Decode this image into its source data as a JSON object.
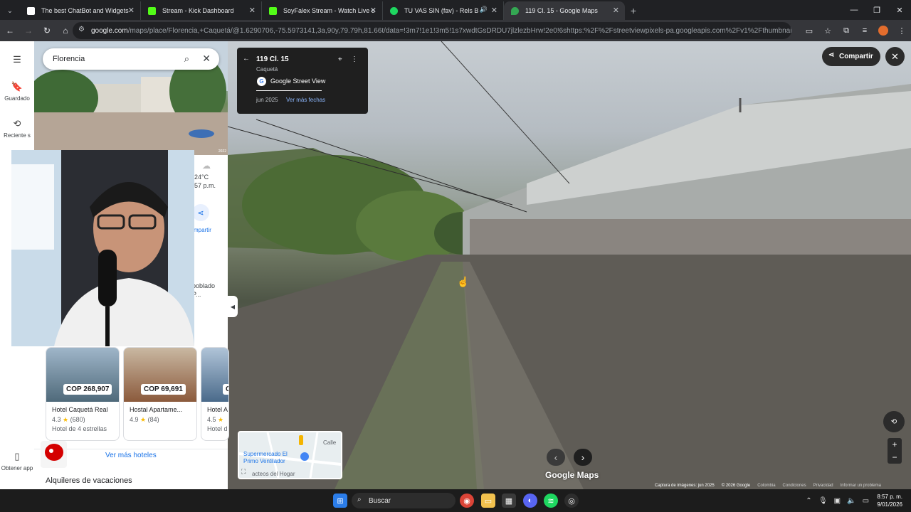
{
  "browser": {
    "tabs": [
      {
        "title": "The best ChatBot and Widgets",
        "favicon_color": "#ffffff"
      },
      {
        "title": "Stream - Kick Dashboard",
        "favicon_color": "#53fc18"
      },
      {
        "title": "SoyFalex Stream - Watch Live o",
        "favicon_color": "#53fc18"
      },
      {
        "title": "TU VAS SIN (fav) - Rels B",
        "favicon_color": "#1ed760"
      },
      {
        "title": "119 Cl. 15 - Google Maps",
        "favicon_color": "#34a853"
      }
    ],
    "url_host": "google.com",
    "url_rest": "/maps/place/Florencia,+Caquetá/@1.6290706,-75.5973141,3a,90y,79.79h,81.66t/data=!3m7!1e1!3m5!1s7xwdtGsDRDU7jlzlezbHrw!2e0!6shttps:%2F%2Fstreetviewpixels-pa.googleapis.com%2Fv1%2Fthumbnail%3Fcb_client%3D..."
  },
  "maps": {
    "search_value": "Florencia",
    "rail": [
      {
        "label": "Guardado"
      },
      {
        "label": "Reciente s"
      },
      {
        "label": "Obtener app"
      }
    ],
    "weather": "24°C",
    "weather_time": "57 p.m.",
    "share_partial": "mpartir",
    "place_partial_1": "poblado",
    "place_partial_2": "P...",
    "photo_year": "2022",
    "hotels": [
      {
        "price": "COP 268,907",
        "name": "Hotel Caquetá Real",
        "rating": "4.3",
        "reviews": "(680)",
        "class": "Hotel de 4 estrellas"
      },
      {
        "price": "COP 69,691",
        "name": "Hostal Apartame...",
        "rating": "4.9",
        "reviews": "(84)",
        "class": ""
      },
      {
        "price": "C",
        "name": "Hotel A",
        "rating": "4.5",
        "reviews": "",
        "class": "Hotel d"
      }
    ],
    "more_hotels": "Ver más hoteles",
    "vacation": "Alquileres de vacaciones"
  },
  "streetview": {
    "address": "119 Cl. 15",
    "region": "Caquetá",
    "source": "Google Street View",
    "date": "jun 2025",
    "more_dates": "Ver más fechas",
    "share": "Compartir",
    "brand": "Google Maps",
    "minimap_labels": [
      "Supermercado El",
      "Primo Ventilador",
      "acteos del Hogar",
      "Calle"
    ],
    "footer": [
      "Captura de imágenes: jun 2025",
      "© 2026 Google",
      "Colombia",
      "Condiciones",
      "Privacidad",
      "Informar un problema"
    ]
  },
  "taskbar": {
    "search": "Buscar",
    "time": "8:57 p. m.",
    "date": "9/01/2026"
  },
  "colors": {
    "accent_link": "#8ab4f8",
    "maps_link": "#1a73e8",
    "star": "#fbbc04"
  }
}
